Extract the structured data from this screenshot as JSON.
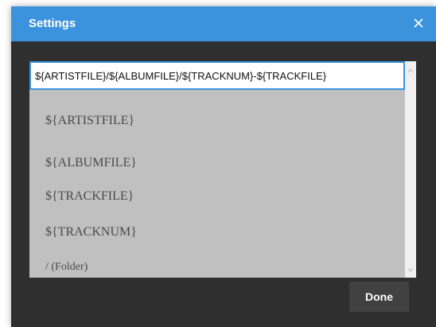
{
  "dialog": {
    "title": "Settings",
    "close_icon": "close-icon",
    "accent_color": "#3a93dc",
    "background_color": "#2f2f2f"
  },
  "pattern": {
    "value": "${ARTISTFILE}/${ALBUMFILE}/${TRACKNUM}-${TRACKFILE}"
  },
  "tokens": [
    {
      "label": "${ARTISTFILE}"
    },
    {
      "label": "${ALBUMFILE}"
    },
    {
      "label": "${TRACKFILE}"
    },
    {
      "label": "${TRACKNUM}"
    },
    {
      "label": "/  (Folder)"
    }
  ],
  "footer": {
    "done_label": "Done"
  }
}
